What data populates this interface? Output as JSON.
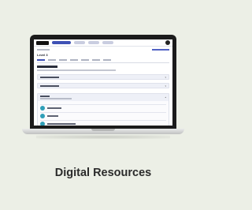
{
  "screen": {
    "page_title": "Level 3",
    "modules": [
      {
        "label": "Module Resources"
      },
      {
        "label": "Module Assessments"
      },
      {
        "label": "Unit 1"
      }
    ],
    "unit_items": [
      {
        "label": ""
      },
      {
        "label": ""
      },
      {
        "label": ""
      }
    ]
  },
  "caption": "Digital Resources",
  "colors": {
    "background": "#ecefe6",
    "accent": "#3f51b5",
    "item_icon": "#2f9fb8"
  }
}
